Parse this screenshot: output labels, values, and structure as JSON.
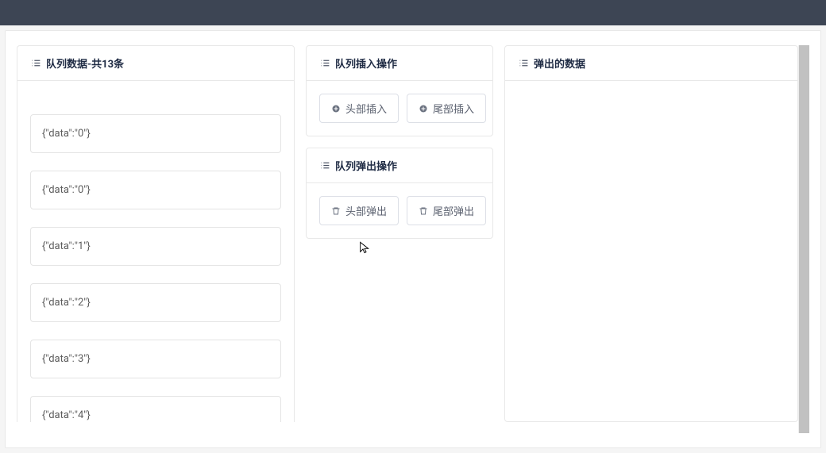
{
  "panels": {
    "queue": {
      "title": "队列数据-共13条",
      "items": [
        {
          "text": "{\"data\":\"0\"}"
        },
        {
          "text": "{\"data\":\"0\"}"
        },
        {
          "text": "{\"data\":\"1\"}"
        },
        {
          "text": "{\"data\":\"2\"}"
        },
        {
          "text": "{\"data\":\"3\"}"
        },
        {
          "text": "{\"data\":\"4\"}"
        }
      ]
    },
    "insert": {
      "title": "队列插入操作",
      "head_btn": "头部插入",
      "tail_btn": "尾部插入"
    },
    "pop": {
      "title": "队列弹出操作",
      "head_btn": "头部弹出",
      "tail_btn": "尾部弹出"
    },
    "popped": {
      "title": "弹出的数据"
    }
  }
}
